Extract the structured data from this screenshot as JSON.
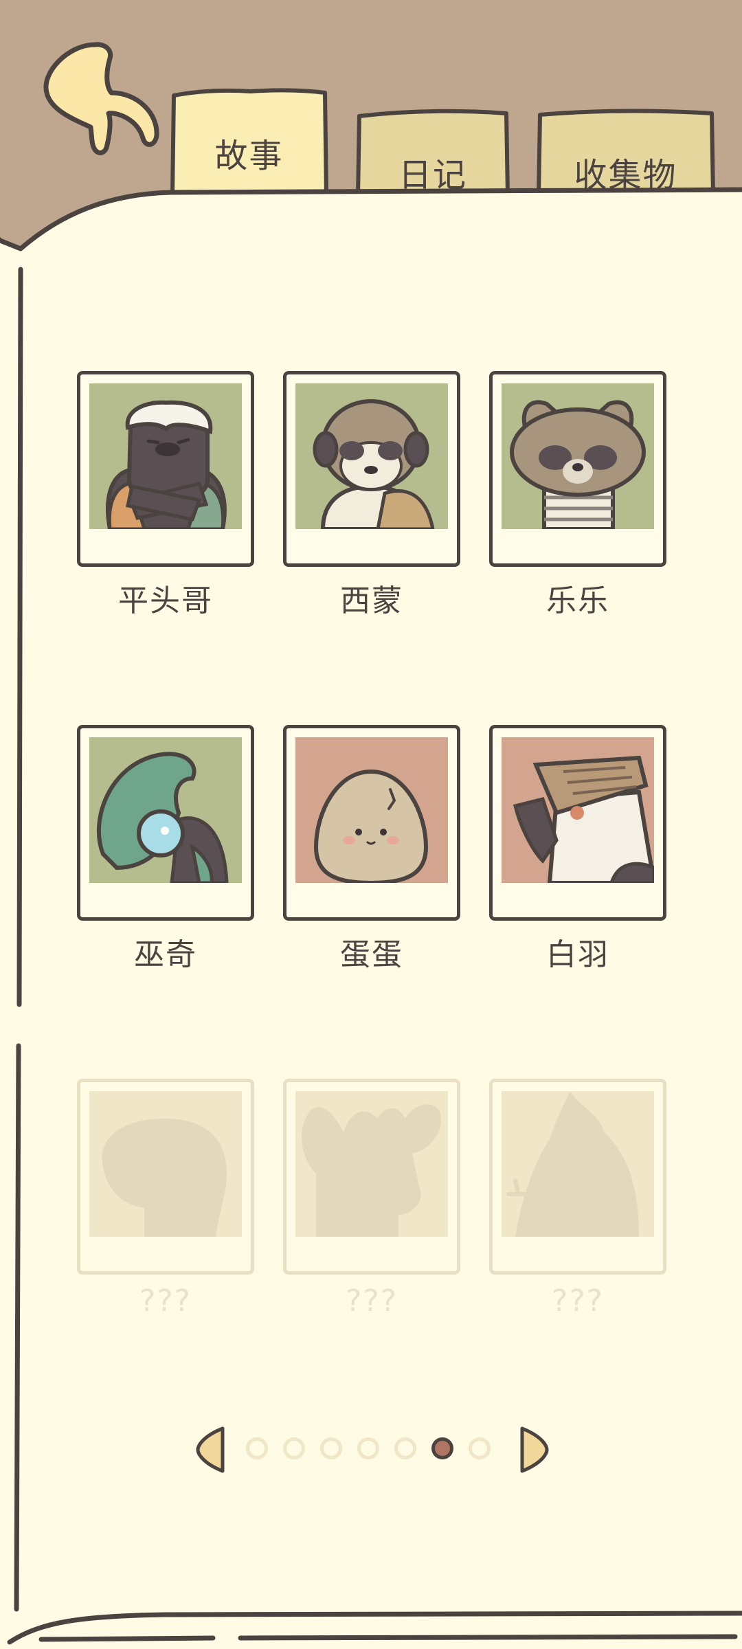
{
  "tabs": [
    {
      "label": "故事",
      "active": true
    },
    {
      "label": "日记",
      "active": false
    },
    {
      "label": "收集物",
      "active": false
    }
  ],
  "characters": [
    {
      "name": "平头哥",
      "icon": "honey-badger-portrait",
      "bg": "#b5bc8e",
      "locked": false
    },
    {
      "name": "西蒙",
      "icon": "meerkat-portrait",
      "bg": "#b5bc8e",
      "locked": false
    },
    {
      "name": "乐乐",
      "icon": "raccoon-dog-portrait",
      "bg": "#b5bc8e",
      "locked": false
    },
    {
      "name": "巫奇",
      "icon": "chameleon-portrait",
      "bg": "#b5bc8e",
      "locked": false
    },
    {
      "name": "蛋蛋",
      "icon": "egg-portrait",
      "bg": "#d3a58f",
      "locked": false
    },
    {
      "name": "白羽",
      "icon": "bird-hat-portrait",
      "bg": "#d3a58f",
      "locked": false
    },
    {
      "name": "???",
      "icon": "locked-silhouette-round",
      "bg": "#f0e7c9",
      "locked": true
    },
    {
      "name": "???",
      "icon": "locked-silhouette-moose",
      "bg": "#f0e7c9",
      "locked": true
    },
    {
      "name": "???",
      "icon": "locked-silhouette-bird",
      "bg": "#f0e7c9",
      "locked": true
    }
  ],
  "pagination": {
    "total": 7,
    "current": 6
  },
  "colors": {
    "background": "#bea68f",
    "paper": "#fffbe4",
    "outline": "#4a4340",
    "active_tab": "#fbeeb4",
    "inactive_tab": "#e6d79f",
    "active_dot": "#b07564"
  }
}
